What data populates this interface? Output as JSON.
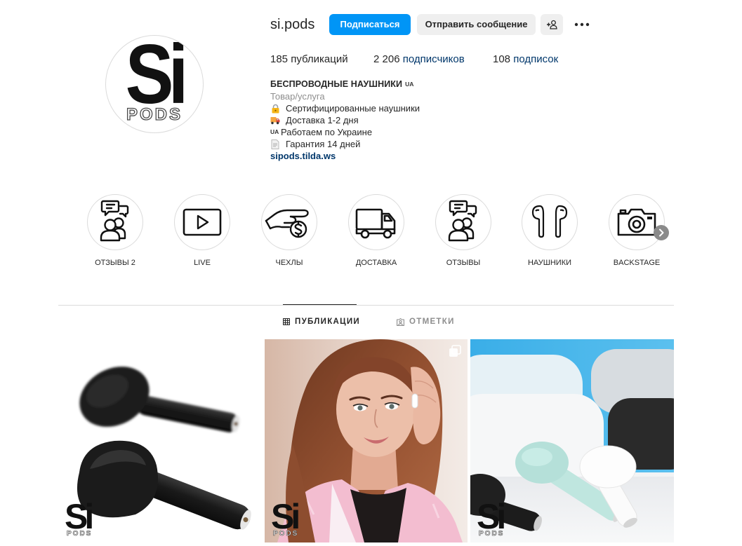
{
  "colors": {
    "accent": "#0095f6",
    "link": "#00376b",
    "text": "#262626",
    "muted": "#8e8e8e",
    "border": "#dbdbdb",
    "button_bg": "#efefef"
  },
  "logo": {
    "big": "Si",
    "small": "PODS"
  },
  "profile": {
    "username": "si.pods",
    "follow_label": "Подписаться",
    "message_label": "Отправить сообщение",
    "add_user_icon": "add-user-icon",
    "more_icon": "more-options-icon"
  },
  "stats": [
    {
      "count": "185",
      "label": "публикаций"
    },
    {
      "count": "2 206",
      "label": "подписчиков"
    },
    {
      "count": "108",
      "label": "подписок"
    }
  ],
  "bio": {
    "name": "БЕСПРОВОДНЫЕ НАУШНИКИ",
    "name_flag": "UA",
    "category": "Товар/услуга",
    "lines": [
      {
        "icon": "lock-icon",
        "text": "Сертифицированные наушники"
      },
      {
        "icon": "truck-icon",
        "text": "Доставка 1-2 дня"
      },
      {
        "flag": "UA",
        "text": "Работаем по Украине"
      },
      {
        "icon": "page-icon",
        "text": "Гарантия 14 дней"
      }
    ],
    "link": "sipods.tilda.ws"
  },
  "highlights": [
    {
      "label": "ОТЗЫВЫ 2",
      "icon": "chat-people-icon"
    },
    {
      "label": "LIVE",
      "icon": "play-icon"
    },
    {
      "label": "ЧЕХЛЫ",
      "icon": "hand-coin-icon"
    },
    {
      "label": "ДОСТАВКА",
      "icon": "truck-icon"
    },
    {
      "label": "ОТЗЫВЫ",
      "icon": "chat-people-icon"
    },
    {
      "label": "НАУШНИКИ",
      "icon": "earbuds-icon"
    },
    {
      "label": "BACKSTAGE",
      "icon": "camera-icon"
    }
  ],
  "highlights_next_icon": "chevron-right-icon",
  "tabs": [
    {
      "label": "ПУБЛИКАЦИИ",
      "icon": "grid-icon",
      "active": true
    },
    {
      "label": "ОТМЕТКИ",
      "icon": "tagged-icon",
      "active": false
    }
  ],
  "posts": [
    {
      "carousel": false
    },
    {
      "carousel": true
    },
    {
      "carousel": false
    }
  ]
}
